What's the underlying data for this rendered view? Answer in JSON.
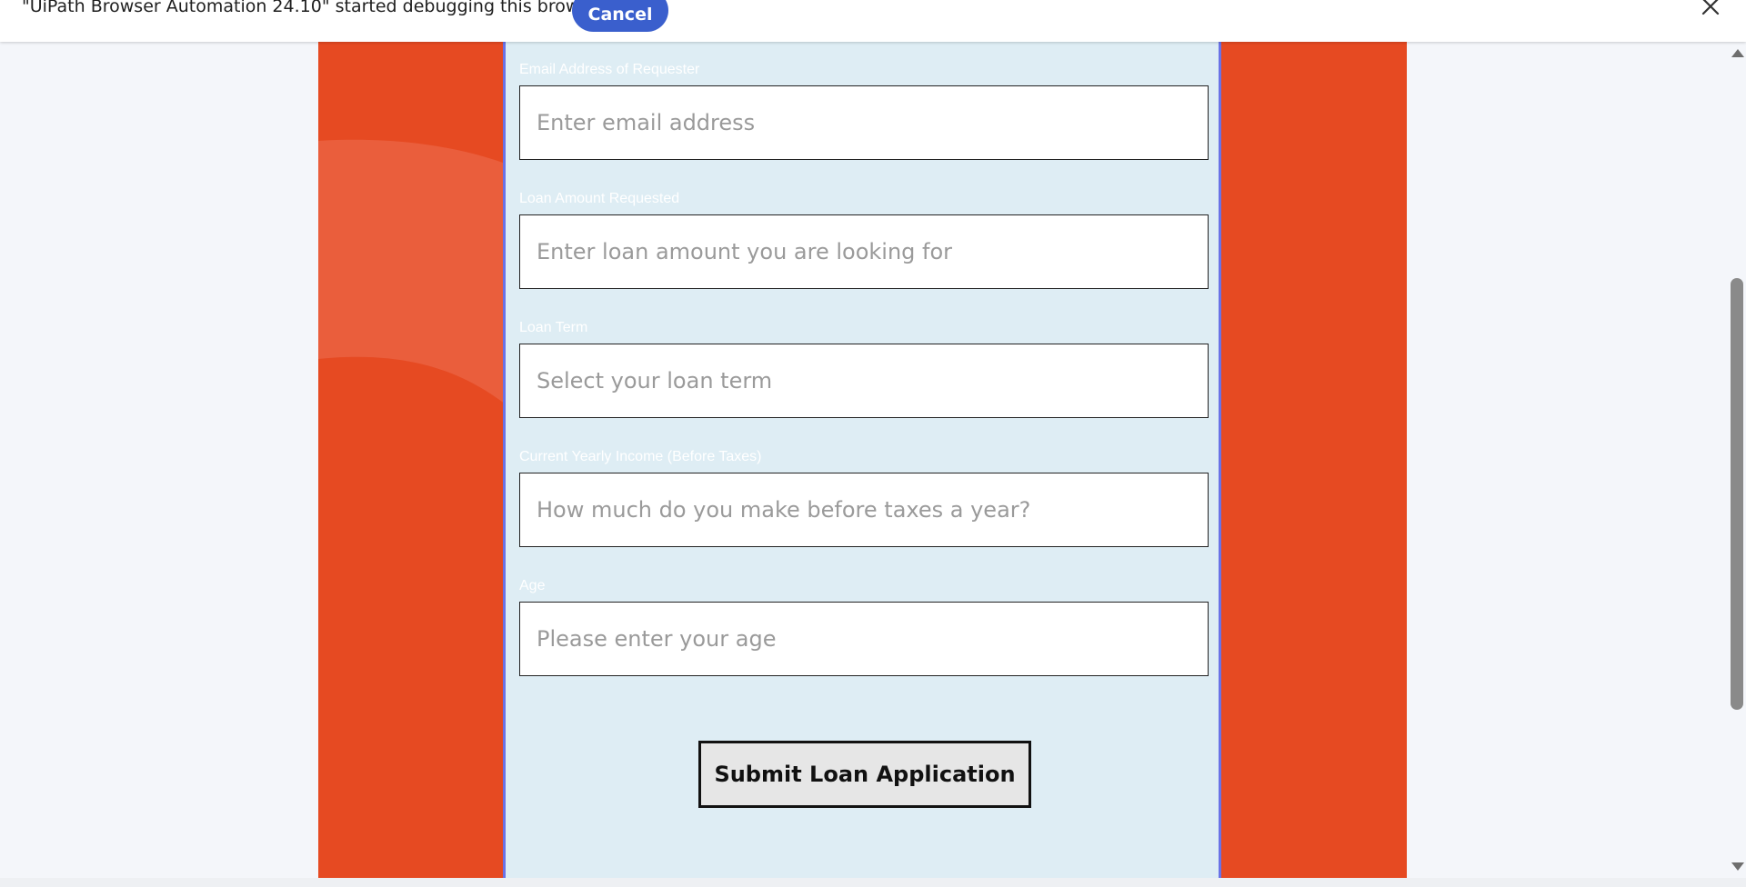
{
  "infobar": {
    "message": "\"UiPath Browser Automation 24.10\" started debugging this browser",
    "cancel_label": "Cancel",
    "close_icon": "close-icon"
  },
  "form": {
    "fields": [
      {
        "label": "Email Address of Requester",
        "placeholder": "Enter email address"
      },
      {
        "label": "Loan Amount Requested",
        "placeholder": "Enter loan amount you are looking for"
      },
      {
        "label": "Loan Term",
        "placeholder": "Select your loan term"
      },
      {
        "label": "Current Yearly Income (Before Taxes)",
        "placeholder": "How much do you make before taxes a year?"
      },
      {
        "label": "Age",
        "placeholder": "Please enter your age"
      }
    ],
    "submit_label": "Submit Loan Application"
  },
  "colors": {
    "brand_orange": "#e64a22",
    "form_background": "#deedf4",
    "form_border": "#6a72e6",
    "cancel_button": "#3a5fcd"
  }
}
